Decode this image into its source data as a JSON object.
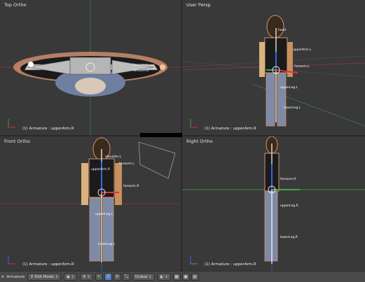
{
  "viewports": {
    "top_left": {
      "title": "Top Ortho",
      "status": "(1) Armature : upperArm.R"
    },
    "top_right": {
      "title": "User Persp",
      "status": "(1) Armature : upperArm.R"
    },
    "bottom_left": {
      "title": "Front Ortho",
      "status": "(1) Armature : upperArm.R"
    },
    "bottom_right": {
      "title": "Right Ortho",
      "status": "(1) Armature : upperArm.R"
    }
  },
  "bone_labels": {
    "front": [
      "upperArm.R",
      "forearm.L",
      "forearm.R",
      "upperLeg.L",
      "lowerLeg.L",
      "shoulder.L"
    ],
    "right": [
      "forearm.R",
      "upperLeg.R",
      "lowerLeg.R"
    ],
    "persp": [
      "head",
      "upperArm.L",
      "forearm.L",
      "upperLeg.L",
      "lowerLeg.L"
    ],
    "top": [
      "forearm.L",
      "forearm.R"
    ]
  },
  "toolbar": {
    "view_menu": "d",
    "object_name": "Armature",
    "mode": "Edit Mode",
    "orientation": "Global"
  },
  "colors": {
    "background": "#393939",
    "accent": "#5680c2",
    "x_axis": "#c83232",
    "y_axis": "#46a546",
    "z_axis": "#3c64e6"
  },
  "icons": [
    "armature-icon",
    "mode-icon",
    "shading-icon",
    "pivot-icon",
    "manipulator-icon",
    "translate-icon",
    "rotate-icon",
    "scale-icon",
    "layer-icon",
    "lock-icon",
    "render-icon"
  ]
}
